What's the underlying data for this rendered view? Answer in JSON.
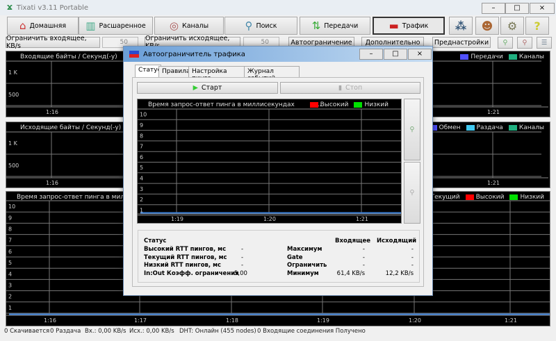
{
  "window": {
    "title": "Tixati v3.11 Portable",
    "controls": [
      "–",
      "□",
      "×"
    ]
  },
  "toolbar": {
    "buttons": [
      {
        "label": "Домашняя",
        "icon": "home-icon"
      },
      {
        "label": "Расшаренное",
        "icon": "books-icon"
      },
      {
        "label": "Каналы",
        "icon": "antenna-icon"
      },
      {
        "label": "Поиск",
        "icon": "search-icon"
      },
      {
        "label": "Передачи",
        "icon": "updown-arrows-icon"
      },
      {
        "label": "Трафик",
        "icon": "traffic-icon",
        "selected": true
      }
    ],
    "icon_buttons": [
      "network-icon",
      "users-icon",
      "gears-icon",
      "help-icon"
    ]
  },
  "limits": {
    "limit_in_label": "Ограничить входящее, KB/s",
    "limit_in_value": "50",
    "limit_out_label": "Ограничить исходящее, KB/s",
    "limit_out_value": "50",
    "auto_label": "Автоограничение",
    "extra_label": "Дополнительно",
    "presets_label": "Преднастройки"
  },
  "panels": {
    "incoming": {
      "title": "Входящие байты / Секунд(-у)",
      "y_labels": [
        "1 K",
        "500"
      ],
      "x_labels": [
        "1:16",
        "1:21"
      ],
      "legend": [
        {
          "label": "Передачи",
          "color": "#5050ff"
        },
        {
          "label": "Каналы",
          "color": "#20b080"
        }
      ]
    },
    "outgoing": {
      "title": "Исходящие байты / Секунд(-у)",
      "y_labels": [
        "1 K",
        "500"
      ],
      "x_labels": [
        "1:16",
        "1:21"
      ],
      "legend": [
        {
          "label": "Обмен",
          "color": "#5050ff"
        },
        {
          "label": "Раздача",
          "color": "#40c8f0"
        },
        {
          "label": "Каналы",
          "color": "#20b080"
        }
      ]
    },
    "ping": {
      "title": "Время запрос-ответ пинга в миллисе",
      "y_labels": [
        "10",
        "9",
        "8",
        "7",
        "6",
        "5",
        "4",
        "3",
        "2",
        "1"
      ],
      "x_labels": [
        "1:16",
        "1:17",
        "1:18",
        "1:19",
        "1:20",
        "1:21"
      ],
      "legend": [
        {
          "label": "Текущий",
          "color": "#5050ff"
        },
        {
          "label": "Высокий",
          "color": "#ff0000"
        },
        {
          "label": "Низкий",
          "color": "#00e000"
        }
      ]
    }
  },
  "dialog": {
    "title": "Автоограничитель трафика",
    "tabs": [
      "Статус",
      "Правила",
      "Настройка пинга",
      "Журнал событий"
    ],
    "start_label": "Старт",
    "stop_label": "Стоп",
    "chart": {
      "title": "Время запрос-ответ пинга в миллисекундах",
      "ellipsis": "...",
      "y_labels": [
        "10",
        "9",
        "8",
        "7",
        "6",
        "5",
        "4",
        "3",
        "2",
        "1"
      ],
      "x_labels": [
        "1:19",
        "1:20",
        "1:21"
      ],
      "legend": [
        {
          "label": "Высокий",
          "color": "#ff0000"
        },
        {
          "label": "Низкий",
          "color": "#00e000"
        }
      ]
    },
    "stats": {
      "status_label": "Статус",
      "rows": [
        {
          "label": "Высокий RTT пингов, мс",
          "value": "-"
        },
        {
          "label": "Текущий RTT пингов, мс",
          "value": "-"
        },
        {
          "label": "Низкий RTT пингов, мс",
          "value": "-"
        },
        {
          "label": "In:Out Коэфф. ограничения",
          "value": "5,00"
        }
      ],
      "col_in": "Входящее",
      "col_out": "Исходящий",
      "limits": [
        {
          "label": "Максимум",
          "in": "-",
          "out": "-"
        },
        {
          "label": "Gate",
          "in": "-",
          "out": "-"
        },
        {
          "label": "Ограничить",
          "in": "-",
          "out": "-"
        },
        {
          "label": "Минимум",
          "in": "61,4 KB/s",
          "out": "12,2 KB/s"
        }
      ]
    }
  },
  "statusbar": [
    "0 Скачивается",
    "0 Раздача",
    "Вх.: 0,00 KB/s",
    "Исх.: 0,00 KB/s",
    "DHT: Онлайн (455 nodes)",
    "0 Входящие соединения Получено"
  ]
}
